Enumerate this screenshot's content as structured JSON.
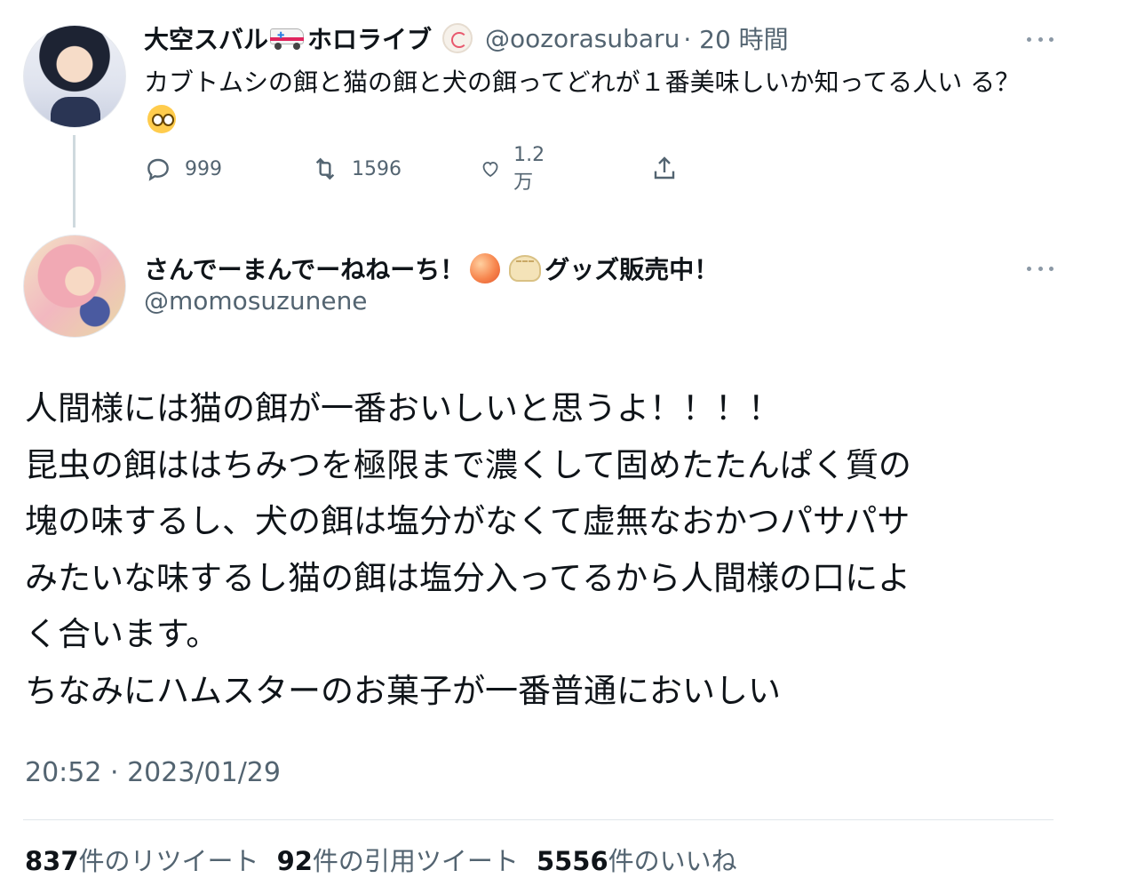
{
  "tweet1": {
    "display_name_part1": "大空スバル",
    "display_name_part2": "ホロライブ",
    "name_emoji": "ambulance-icon",
    "badge_icon": "naruto-icon",
    "handle": "@oozorasubaru",
    "time": "· 20 時間",
    "text": "カブトムシの餌と猫の餌と犬の餌ってどれが１番美味しいか知ってる人い る？",
    "text_emoji": "pleading-face-icon",
    "reply_count": "999",
    "retweet_count": "1596",
    "like_count": "1.2万"
  },
  "tweet2": {
    "display_name_part1": "さんでーまんでーねねーち！",
    "display_name_part2": "グッズ販売中！",
    "name_emojis": [
      "peach-icon",
      "dumpling-icon"
    ],
    "handle": "@momosuzunene",
    "text_lines": [
      "人間様には猫の餌が一番おいしいと思うよ！！！！",
      "昆虫の餌ははちみつを極限まで濃くして固めたたんぱく質の",
      "塊の味するし、犬の餌は塩分がなくて虚無なおかつパサパサ",
      "みたいな味するし猫の餌は塩分入ってるから人間様の口によ",
      "く合います。",
      "ちなみにハムスターのお菓子が一番普通においしい"
    ],
    "timestamp": "20:52 · 2023/01/29",
    "stats": {
      "retweets_num": "837",
      "retweets_label": "件のリツイート",
      "quotes_num": "92",
      "quotes_label": "件の引用ツイート",
      "likes_num": "5556",
      "likes_label": "件のいいね"
    }
  },
  "colors": {
    "text": "#0f1419",
    "secondary": "#536471",
    "line": "#cfd9de"
  }
}
